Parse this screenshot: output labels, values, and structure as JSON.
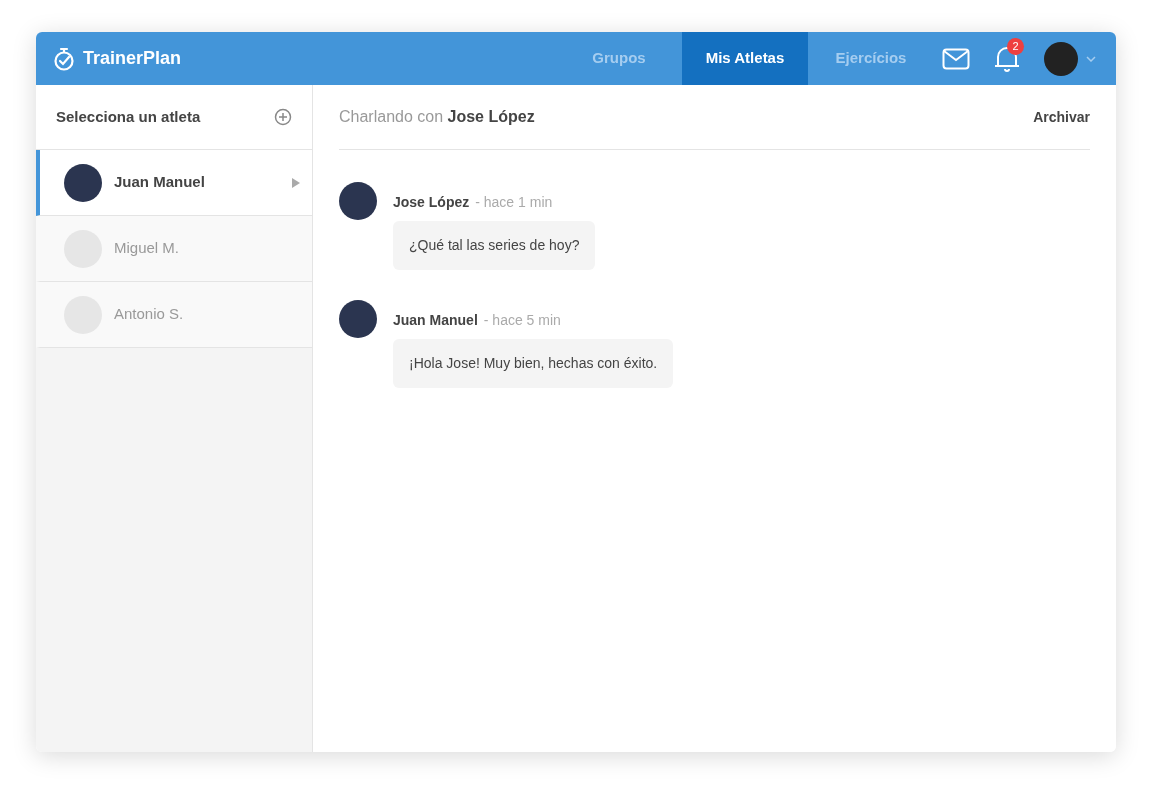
{
  "app": {
    "logo": "TrainerPlan"
  },
  "nav_tabs": [
    {
      "label": "Grupos",
      "selected": false
    },
    {
      "label": "Mis Atletas",
      "selected": true
    },
    {
      "label": "Ejercícios",
      "selected": false
    }
  ],
  "notifications": {
    "count": "2"
  },
  "sidebar": {
    "title": "Selecciona un atleta",
    "athletes": [
      {
        "name": "Juan Manuel",
        "selected": true,
        "kind": "photo"
      },
      {
        "name": "Miguel M.",
        "selected": false,
        "kind": "empty"
      },
      {
        "name": "Antonio S.",
        "selected": false,
        "kind": "empty"
      }
    ]
  },
  "chat": {
    "prefix": "Charlando con",
    "partner": "Jose López",
    "archive": "Archivar",
    "messages": [
      {
        "sender": "Jose López",
        "time": "- hace 1 min",
        "text": "¿Qué tal las series de hoy?"
      },
      {
        "sender": "Juan Manuel",
        "time": "- hace 5 min",
        "text": "¡Hola Jose! Muy bien, hechas con éxito."
      }
    ]
  }
}
